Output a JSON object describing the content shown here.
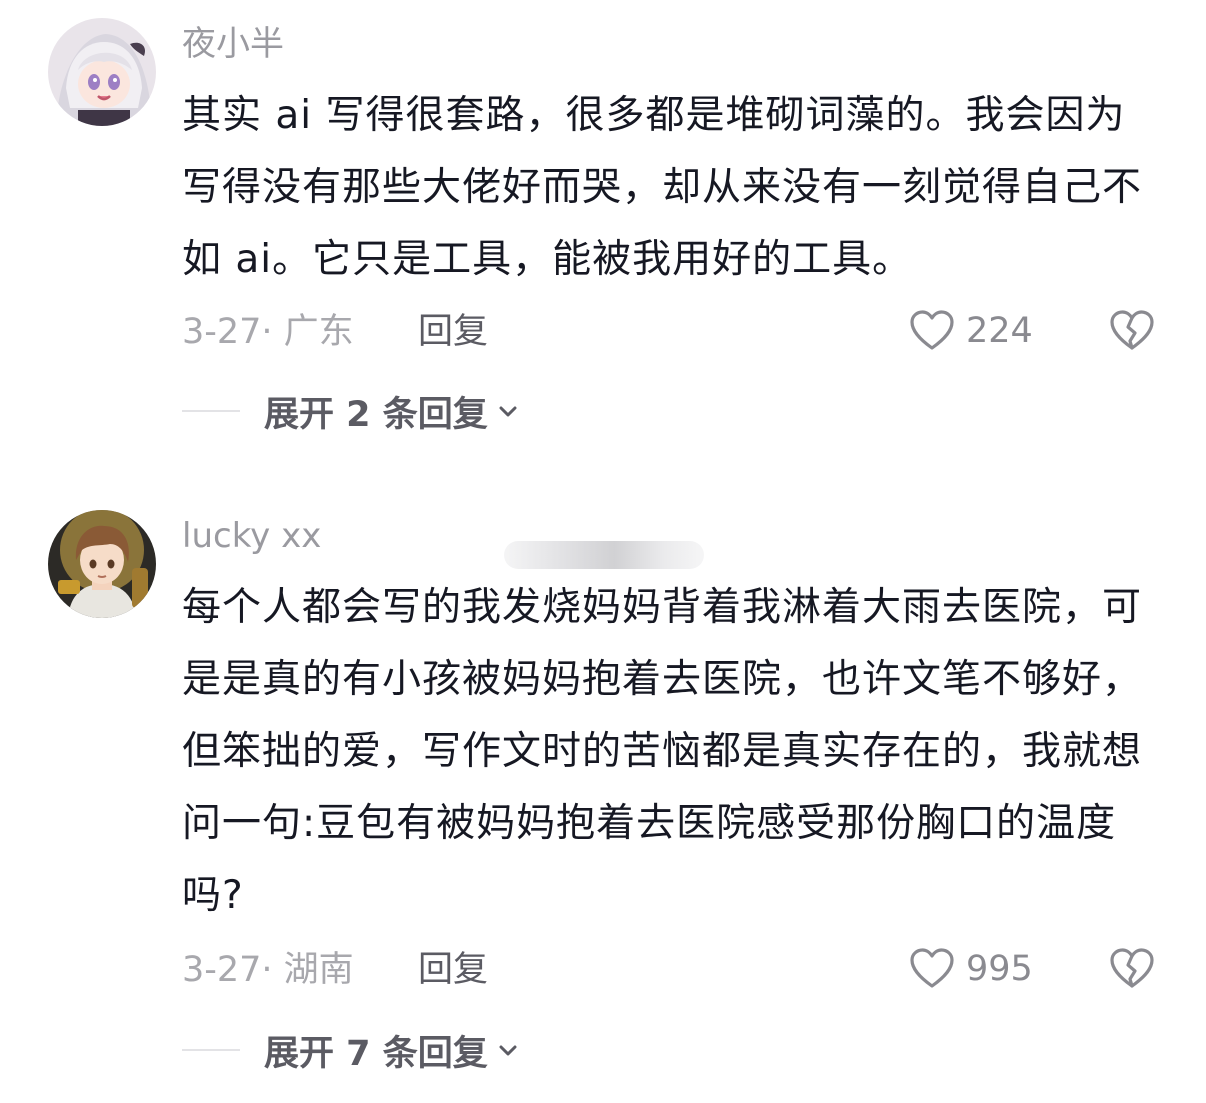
{
  "comments": [
    {
      "username": "夜小半",
      "text": "其实 ai 写得很套路，很多都是堆砌词藻的。我会因为写得没有那些大佬好而哭，却从来没有一刻觉得自己不如 ai。它只是工具，能被我用好的工具。",
      "date_location": "3-27· 广东",
      "reply_label": "回复",
      "likes": "224",
      "expand_label": "展开 2 条回复"
    },
    {
      "username": "lucky xx",
      "text": "每个人都会写的我发烧妈妈背着我淋着大雨去医院，可是是真的有小孩被妈妈抱着去医院，也许文笔不够好，但笨拙的爱，写作文时的苦恼都是真实存在的，我就想问一句:豆包有被妈妈抱着去医院感受那份胸口的温度吗?",
      "date_location": "3-27· 湖南",
      "reply_label": "回复",
      "likes": "995",
      "expand_label": "展开 7 条回复"
    }
  ],
  "colors": {
    "text": "#161823",
    "muted": "#a8a8ad",
    "username": "#9a9aa0",
    "action": "#5b5b63"
  },
  "icons": [
    "avatar-anime-girl",
    "avatar-anime-boy",
    "heart-icon",
    "broken-heart-icon",
    "chevron-down-icon"
  ]
}
